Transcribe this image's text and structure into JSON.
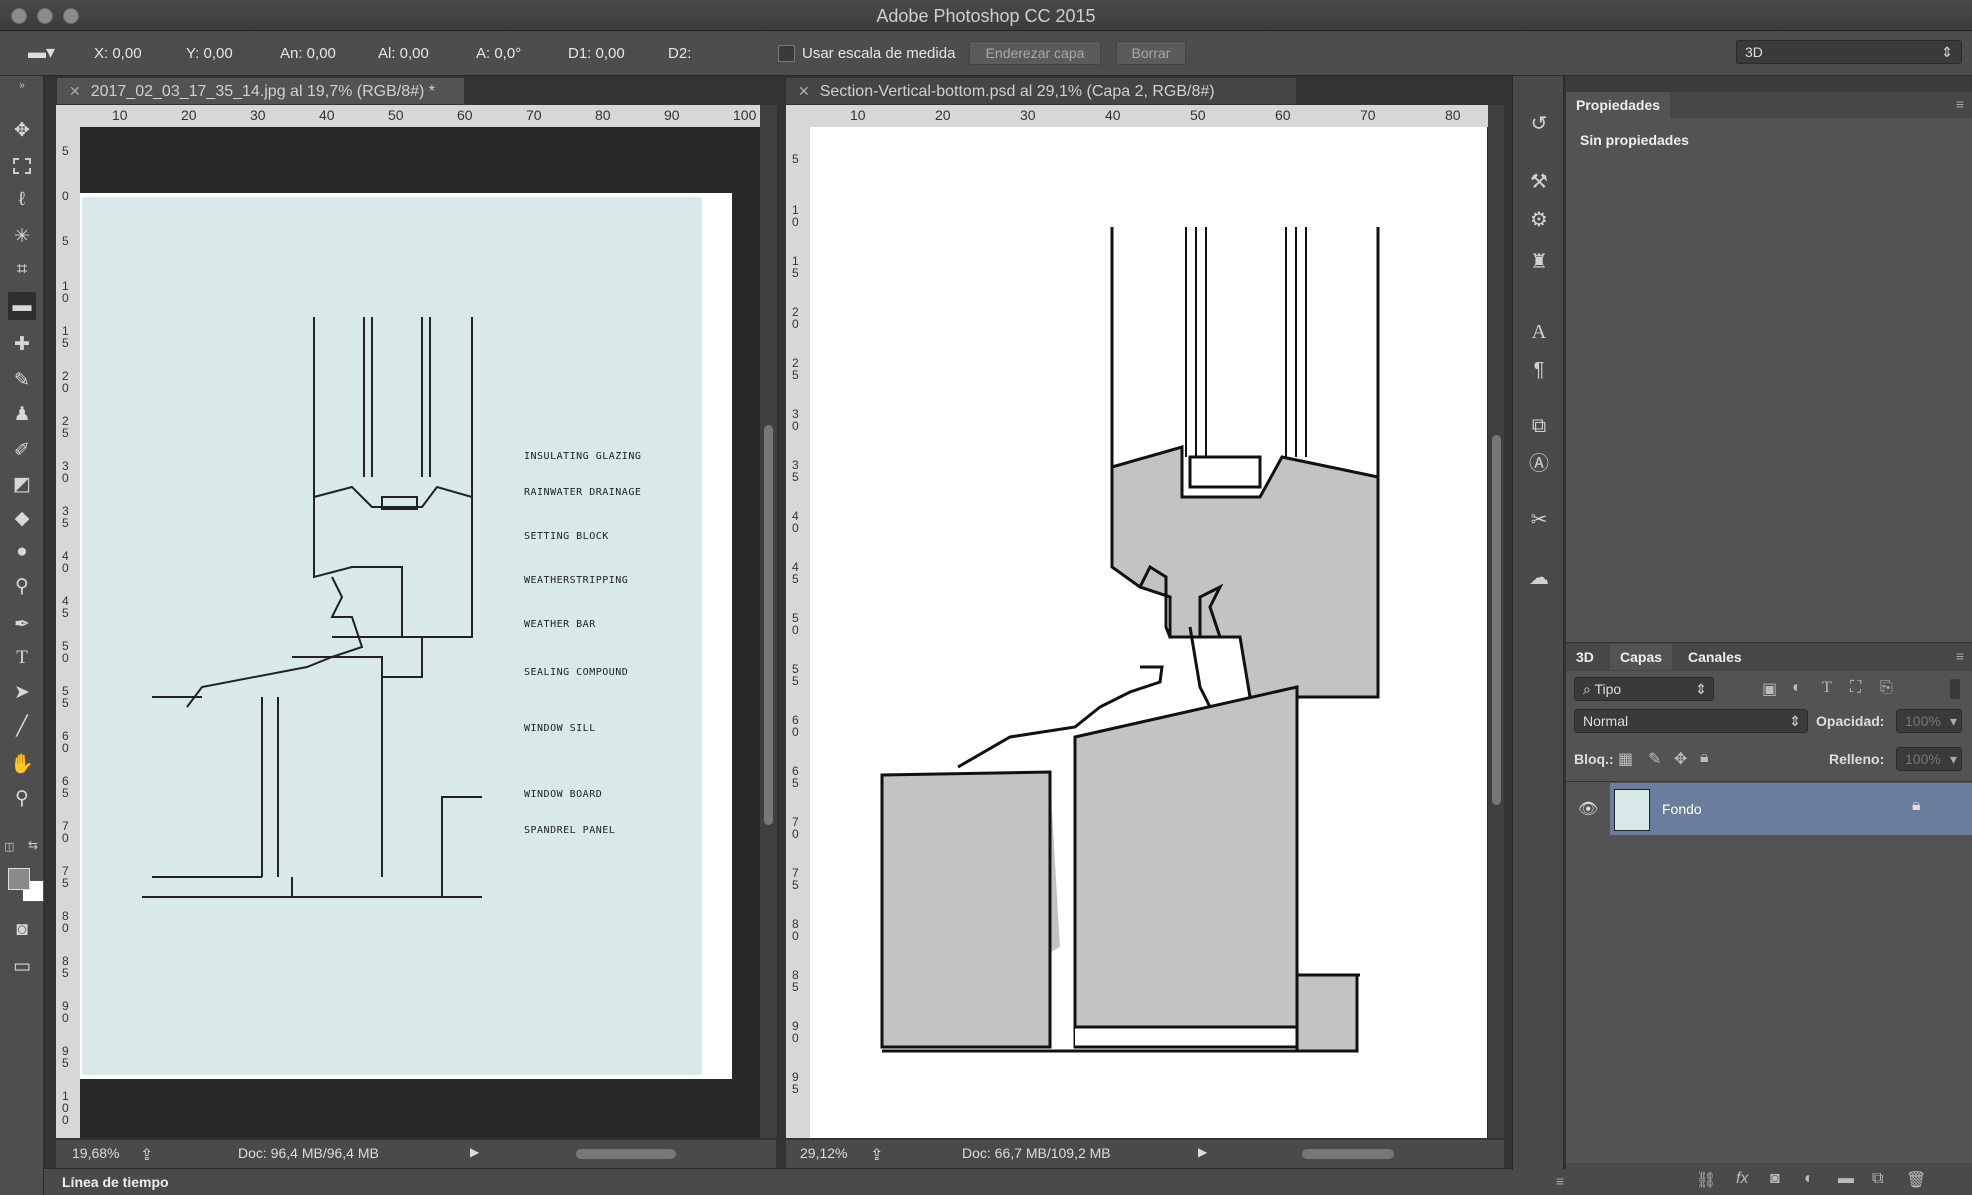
{
  "app": {
    "title": "Adobe Photoshop CC 2015"
  },
  "options": {
    "x": "X: 0,00",
    "y": "Y: 0,00",
    "w": "An: 0,00",
    "h": "Al: 0,00",
    "angle": "A: 0,0°",
    "d1": "D1: 0,00",
    "d2": "D2:",
    "use_scale": "Usar escala de medida",
    "straighten": "Enderezar capa",
    "clear": "Borrar",
    "workspace": "3D"
  },
  "doc1": {
    "tab": "2017_02_03_17_35_14.jpg al 19,7% (RGB/8#) *",
    "zoom": "19,68%",
    "docsize": "Doc: 96,4 MB/96,4 MB",
    "ruler_h": [
      "10",
      "20",
      "30",
      "40",
      "50",
      "60",
      "70",
      "80",
      "90",
      "100"
    ],
    "ruler_v": [
      "5",
      "0",
      "5",
      "1 0",
      "1 5",
      "2 0",
      "2 5",
      "3 0",
      "3 5",
      "4 0",
      "4 5",
      "5 0",
      "5 5",
      "6 0",
      "6 5",
      "7 0",
      "7 5",
      "8 0",
      "8 5",
      "9 0",
      "9 5",
      "1 0 0"
    ],
    "labels": [
      "INSULATING GLAZING",
      "RAINWATER DRAINAGE",
      "SETTING BLOCK",
      "WEATHERSTRIPPING",
      "WEATHER BAR",
      "SEALING COMPOUND",
      "WINDOW SILL",
      "WINDOW BOARD",
      "SPANDREL PANEL"
    ]
  },
  "doc2": {
    "tab": "Section-Vertical-bottom.psd al 29,1% (Capa 2, RGB/8#)",
    "zoom": "29,12%",
    "docsize": "Doc: 66,7 MB/109,2 MB",
    "ruler_h": [
      "10",
      "20",
      "30",
      "40",
      "50",
      "60",
      "70",
      "80"
    ],
    "ruler_v": [
      "5",
      "1 0",
      "1 5",
      "2 0",
      "2 5",
      "3 0",
      "3 5",
      "4 0",
      "4 5",
      "5 0",
      "5 5",
      "6 0",
      "6 5",
      "7 0",
      "7 5",
      "8 0",
      "8 5",
      "9 0",
      "9 5"
    ]
  },
  "timeline": {
    "label": "Línea de tiempo"
  },
  "properties": {
    "tab": "Propiedades",
    "empty": "Sin propiedades"
  },
  "layers_panel": {
    "tabs": [
      "3D",
      "Capas",
      "Canales"
    ],
    "filter": "Tipo",
    "blend": "Normal",
    "opacity_label": "Opacidad:",
    "opacity": "100%",
    "lock_label": "Bloq.:",
    "fill_label": "Relleno:",
    "fill": "100%",
    "layer_name": "Fondo"
  },
  "colors": {
    "accent": "#6b7f9c",
    "layer_selected": "#6a7d9c",
    "canvas_bg": "#282828"
  }
}
